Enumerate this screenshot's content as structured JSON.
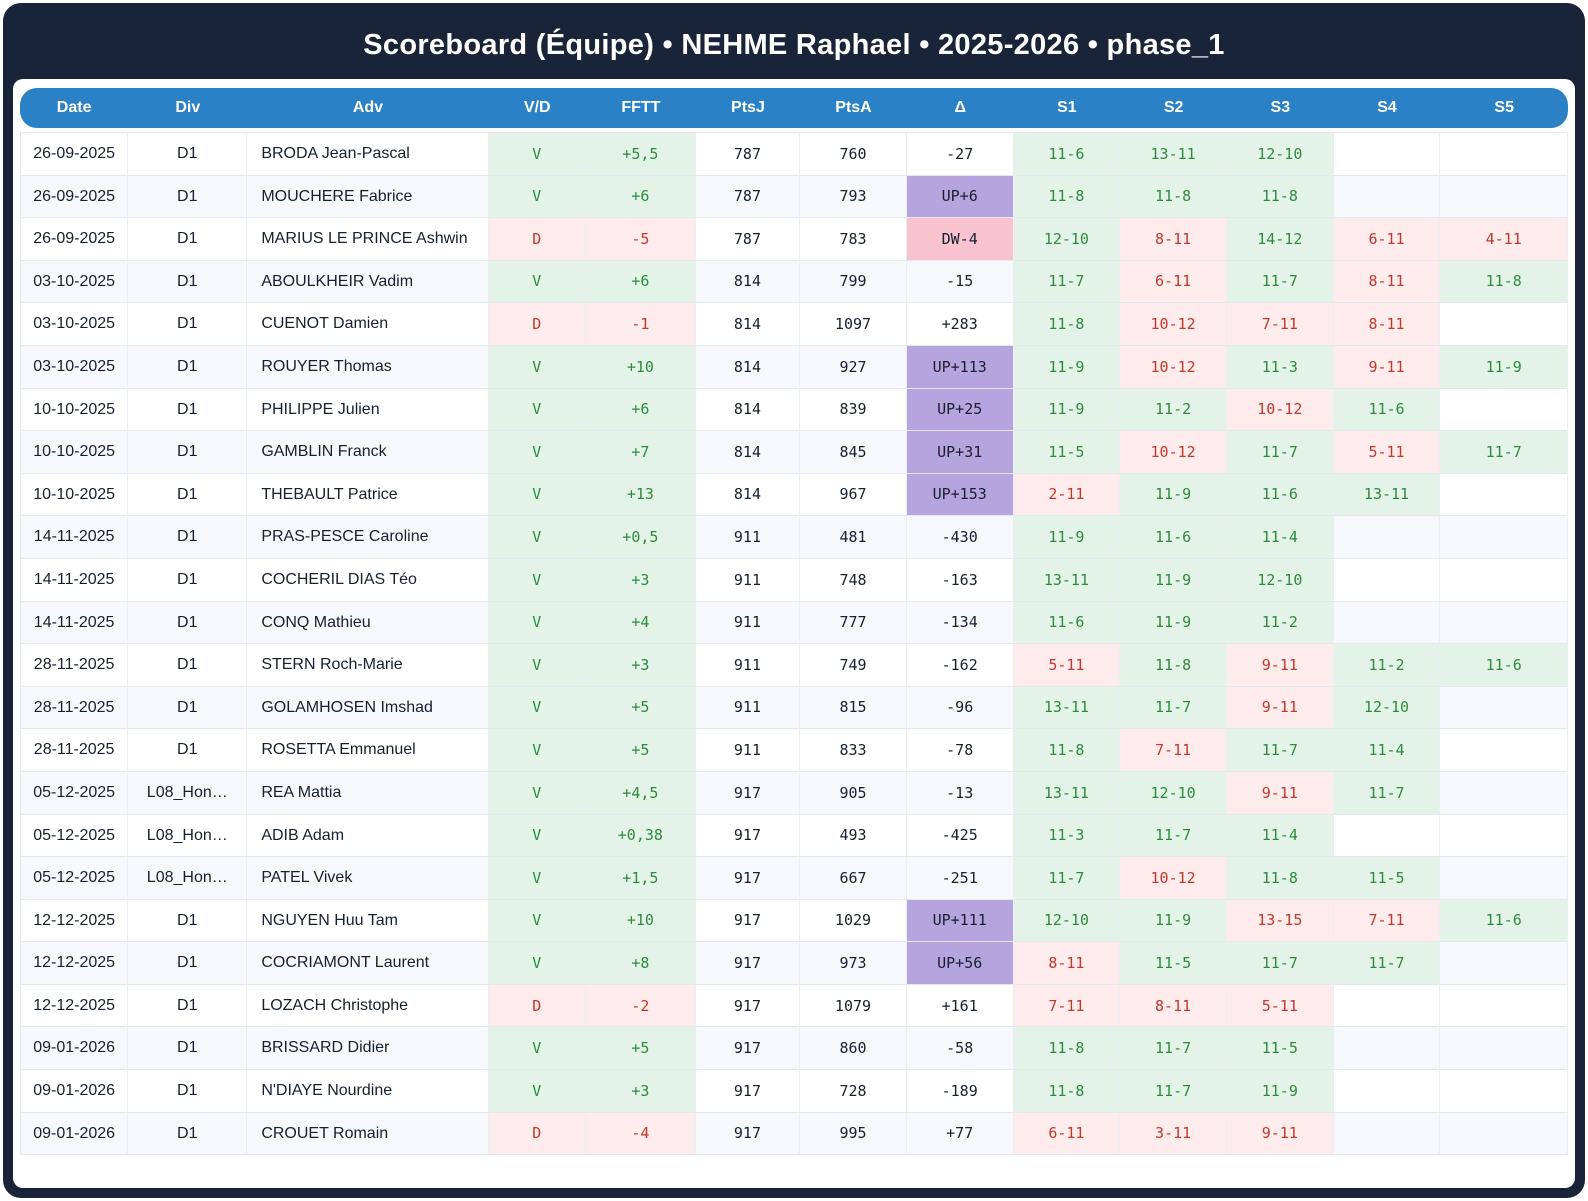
{
  "title": "Scoreboard (Équipe) • NEHME Raphael • 2025-2026 • phase_1",
  "colors": {
    "frame_navy": "#1a2438",
    "header_blue": "#2a81c5",
    "win_bg": "#e4f3e8",
    "win_text": "#2e8b3e",
    "loss_bg": "#fdeceb",
    "loss_text": "#c0392b",
    "delta_up_bg": "#b6a4de",
    "delta_down_bg": "#f9c2cf",
    "alt_row_bg": "#f7f8fc"
  },
  "table": {
    "columns": [
      "Date",
      "Div",
      "Adv",
      "V/D",
      "FFTT",
      "PtsJ",
      "PtsA",
      "Δ",
      "S1",
      "S2",
      "S3",
      "S4",
      "S5"
    ],
    "rows": [
      {
        "date": "26-09-2025",
        "div": "D1",
        "adv": "BRODA Jean-Pascal",
        "vd": "V",
        "fftt": "+5,5",
        "ptsj": "787",
        "ptsa": "760",
        "delta": "-27",
        "delta_type": "none",
        "sets": [
          {
            "score": "11-6",
            "win": true
          },
          {
            "score": "13-11",
            "win": true
          },
          {
            "score": "12-10",
            "win": true
          },
          null,
          null
        ]
      },
      {
        "date": "26-09-2025",
        "div": "D1",
        "adv": "MOUCHERE Fabrice",
        "vd": "V",
        "fftt": "+6",
        "ptsj": "787",
        "ptsa": "793",
        "delta": "UP+6",
        "delta_type": "up",
        "sets": [
          {
            "score": "11-8",
            "win": true
          },
          {
            "score": "11-8",
            "win": true
          },
          {
            "score": "11-8",
            "win": true
          },
          null,
          null
        ]
      },
      {
        "date": "26-09-2025",
        "div": "D1",
        "adv": "MARIUS LE PRINCE Ashwin",
        "vd": "D",
        "fftt": "-5",
        "ptsj": "787",
        "ptsa": "783",
        "delta": "DW-4",
        "delta_type": "down",
        "sets": [
          {
            "score": "12-10",
            "win": true
          },
          {
            "score": "8-11",
            "win": false
          },
          {
            "score": "14-12",
            "win": true
          },
          {
            "score": "6-11",
            "win": false
          },
          {
            "score": "4-11",
            "win": false
          }
        ]
      },
      {
        "date": "03-10-2025",
        "div": "D1",
        "adv": "ABOULKHEIR Vadim",
        "vd": "V",
        "fftt": "+6",
        "ptsj": "814",
        "ptsa": "799",
        "delta": "-15",
        "delta_type": "none",
        "sets": [
          {
            "score": "11-7",
            "win": true
          },
          {
            "score": "6-11",
            "win": false
          },
          {
            "score": "11-7",
            "win": true
          },
          {
            "score": "8-11",
            "win": false
          },
          {
            "score": "11-8",
            "win": true
          }
        ]
      },
      {
        "date": "03-10-2025",
        "div": "D1",
        "adv": "CUENOT Damien",
        "vd": "D",
        "fftt": "-1",
        "ptsj": "814",
        "ptsa": "1097",
        "delta": "+283",
        "delta_type": "none",
        "sets": [
          {
            "score": "11-8",
            "win": true
          },
          {
            "score": "10-12",
            "win": false
          },
          {
            "score": "7-11",
            "win": false
          },
          {
            "score": "8-11",
            "win": false
          },
          null
        ]
      },
      {
        "date": "03-10-2025",
        "div": "D1",
        "adv": "ROUYER Thomas",
        "vd": "V",
        "fftt": "+10",
        "ptsj": "814",
        "ptsa": "927",
        "delta": "UP+113",
        "delta_type": "up",
        "sets": [
          {
            "score": "11-9",
            "win": true
          },
          {
            "score": "10-12",
            "win": false
          },
          {
            "score": "11-3",
            "win": true
          },
          {
            "score": "9-11",
            "win": false
          },
          {
            "score": "11-9",
            "win": true
          }
        ]
      },
      {
        "date": "10-10-2025",
        "div": "D1",
        "adv": "PHILIPPE Julien",
        "vd": "V",
        "fftt": "+6",
        "ptsj": "814",
        "ptsa": "839",
        "delta": "UP+25",
        "delta_type": "up",
        "sets": [
          {
            "score": "11-9",
            "win": true
          },
          {
            "score": "11-2",
            "win": true
          },
          {
            "score": "10-12",
            "win": false
          },
          {
            "score": "11-6",
            "win": true
          },
          null
        ]
      },
      {
        "date": "10-10-2025",
        "div": "D1",
        "adv": "GAMBLIN Franck",
        "vd": "V",
        "fftt": "+7",
        "ptsj": "814",
        "ptsa": "845",
        "delta": "UP+31",
        "delta_type": "up",
        "sets": [
          {
            "score": "11-5",
            "win": true
          },
          {
            "score": "10-12",
            "win": false
          },
          {
            "score": "11-7",
            "win": true
          },
          {
            "score": "5-11",
            "win": false
          },
          {
            "score": "11-7",
            "win": true
          }
        ]
      },
      {
        "date": "10-10-2025",
        "div": "D1",
        "adv": "THEBAULT Patrice",
        "vd": "V",
        "fftt": "+13",
        "ptsj": "814",
        "ptsa": "967",
        "delta": "UP+153",
        "delta_type": "up",
        "sets": [
          {
            "score": "2-11",
            "win": false
          },
          {
            "score": "11-9",
            "win": true
          },
          {
            "score": "11-6",
            "win": true
          },
          {
            "score": "13-11",
            "win": true
          },
          null
        ]
      },
      {
        "date": "14-11-2025",
        "div": "D1",
        "adv": "PRAS-PESCE Caroline",
        "vd": "V",
        "fftt": "+0,5",
        "ptsj": "911",
        "ptsa": "481",
        "delta": "-430",
        "delta_type": "none",
        "sets": [
          {
            "score": "11-9",
            "win": true
          },
          {
            "score": "11-6",
            "win": true
          },
          {
            "score": "11-4",
            "win": true
          },
          null,
          null
        ]
      },
      {
        "date": "14-11-2025",
        "div": "D1",
        "adv": "COCHERIL DIAS Téo",
        "vd": "V",
        "fftt": "+3",
        "ptsj": "911",
        "ptsa": "748",
        "delta": "-163",
        "delta_type": "none",
        "sets": [
          {
            "score": "13-11",
            "win": true
          },
          {
            "score": "11-9",
            "win": true
          },
          {
            "score": "12-10",
            "win": true
          },
          null,
          null
        ]
      },
      {
        "date": "14-11-2025",
        "div": "D1",
        "adv": "CONQ Mathieu",
        "vd": "V",
        "fftt": "+4",
        "ptsj": "911",
        "ptsa": "777",
        "delta": "-134",
        "delta_type": "none",
        "sets": [
          {
            "score": "11-6",
            "win": true
          },
          {
            "score": "11-9",
            "win": true
          },
          {
            "score": "11-2",
            "win": true
          },
          null,
          null
        ]
      },
      {
        "date": "28-11-2025",
        "div": "D1",
        "adv": "STERN Roch-Marie",
        "vd": "V",
        "fftt": "+3",
        "ptsj": "911",
        "ptsa": "749",
        "delta": "-162",
        "delta_type": "none",
        "sets": [
          {
            "score": "5-11",
            "win": false
          },
          {
            "score": "11-8",
            "win": true
          },
          {
            "score": "9-11",
            "win": false
          },
          {
            "score": "11-2",
            "win": true
          },
          {
            "score": "11-6",
            "win": true
          }
        ]
      },
      {
        "date": "28-11-2025",
        "div": "D1",
        "adv": "GOLAMHOSEN Imshad",
        "vd": "V",
        "fftt": "+5",
        "ptsj": "911",
        "ptsa": "815",
        "delta": "-96",
        "delta_type": "none",
        "sets": [
          {
            "score": "13-11",
            "win": true
          },
          {
            "score": "11-7",
            "win": true
          },
          {
            "score": "9-11",
            "win": false
          },
          {
            "score": "12-10",
            "win": true
          },
          null
        ]
      },
      {
        "date": "28-11-2025",
        "div": "D1",
        "adv": "ROSETTA Emmanuel",
        "vd": "V",
        "fftt": "+5",
        "ptsj": "911",
        "ptsa": "833",
        "delta": "-78",
        "delta_type": "none",
        "sets": [
          {
            "score": "11-8",
            "win": true
          },
          {
            "score": "7-11",
            "win": false
          },
          {
            "score": "11-7",
            "win": true
          },
          {
            "score": "11-4",
            "win": true
          },
          null
        ]
      },
      {
        "date": "05-12-2025",
        "div": "L08_Hon…",
        "adv": "REA Mattia",
        "vd": "V",
        "fftt": "+4,5",
        "ptsj": "917",
        "ptsa": "905",
        "delta": "-13",
        "delta_type": "none",
        "sets": [
          {
            "score": "13-11",
            "win": true
          },
          {
            "score": "12-10",
            "win": true
          },
          {
            "score": "9-11",
            "win": false
          },
          {
            "score": "11-7",
            "win": true
          },
          null
        ]
      },
      {
        "date": "05-12-2025",
        "div": "L08_Hon…",
        "adv": "ADIB Adam",
        "vd": "V",
        "fftt": "+0,38",
        "ptsj": "917",
        "ptsa": "493",
        "delta": "-425",
        "delta_type": "none",
        "sets": [
          {
            "score": "11-3",
            "win": true
          },
          {
            "score": "11-7",
            "win": true
          },
          {
            "score": "11-4",
            "win": true
          },
          null,
          null
        ]
      },
      {
        "date": "05-12-2025",
        "div": "L08_Hon…",
        "adv": "PATEL Vivek",
        "vd": "V",
        "fftt": "+1,5",
        "ptsj": "917",
        "ptsa": "667",
        "delta": "-251",
        "delta_type": "none",
        "sets": [
          {
            "score": "11-7",
            "win": true
          },
          {
            "score": "10-12",
            "win": false
          },
          {
            "score": "11-8",
            "win": true
          },
          {
            "score": "11-5",
            "win": true
          },
          null
        ]
      },
      {
        "date": "12-12-2025",
        "div": "D1",
        "adv": "NGUYEN Huu Tam",
        "vd": "V",
        "fftt": "+10",
        "ptsj": "917",
        "ptsa": "1029",
        "delta": "UP+111",
        "delta_type": "up",
        "sets": [
          {
            "score": "12-10",
            "win": true
          },
          {
            "score": "11-9",
            "win": true
          },
          {
            "score": "13-15",
            "win": false
          },
          {
            "score": "7-11",
            "win": false
          },
          {
            "score": "11-6",
            "win": true
          }
        ]
      },
      {
        "date": "12-12-2025",
        "div": "D1",
        "adv": "COCRIAMONT Laurent",
        "vd": "V",
        "fftt": "+8",
        "ptsj": "917",
        "ptsa": "973",
        "delta": "UP+56",
        "delta_type": "up",
        "sets": [
          {
            "score": "8-11",
            "win": false
          },
          {
            "score": "11-5",
            "win": true
          },
          {
            "score": "11-7",
            "win": true
          },
          {
            "score": "11-7",
            "win": true
          },
          null
        ]
      },
      {
        "date": "12-12-2025",
        "div": "D1",
        "adv": "LOZACH Christophe",
        "vd": "D",
        "fftt": "-2",
        "ptsj": "917",
        "ptsa": "1079",
        "delta": "+161",
        "delta_type": "none",
        "sets": [
          {
            "score": "7-11",
            "win": false
          },
          {
            "score": "8-11",
            "win": false
          },
          {
            "score": "5-11",
            "win": false
          },
          null,
          null
        ]
      },
      {
        "date": "09-01-2026",
        "div": "D1",
        "adv": "BRISSARD Didier",
        "vd": "V",
        "fftt": "+5",
        "ptsj": "917",
        "ptsa": "860",
        "delta": "-58",
        "delta_type": "none",
        "sets": [
          {
            "score": "11-8",
            "win": true
          },
          {
            "score": "11-7",
            "win": true
          },
          {
            "score": "11-5",
            "win": true
          },
          null,
          null
        ]
      },
      {
        "date": "09-01-2026",
        "div": "D1",
        "adv": "N'DIAYE Nourdine",
        "vd": "V",
        "fftt": "+3",
        "ptsj": "917",
        "ptsa": "728",
        "delta": "-189",
        "delta_type": "none",
        "sets": [
          {
            "score": "11-8",
            "win": true
          },
          {
            "score": "11-7",
            "win": true
          },
          {
            "score": "11-9",
            "win": true
          },
          null,
          null
        ]
      },
      {
        "date": "09-01-2026",
        "div": "D1",
        "adv": "CROUET Romain",
        "vd": "D",
        "fftt": "-4",
        "ptsj": "917",
        "ptsa": "995",
        "delta": "+77",
        "delta_type": "none",
        "sets": [
          {
            "score": "6-11",
            "win": false
          },
          {
            "score": "3-11",
            "win": false
          },
          {
            "score": "9-11",
            "win": false
          },
          null,
          null
        ]
      }
    ]
  }
}
